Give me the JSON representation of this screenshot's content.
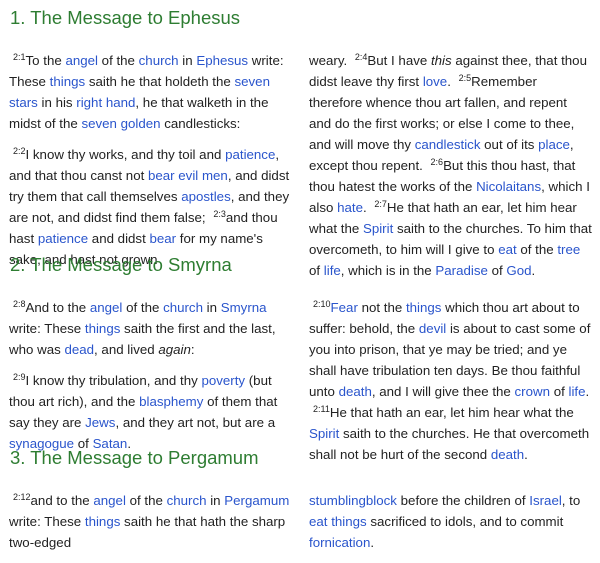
{
  "sections": [
    {
      "heading": "1. The Message to Ephesus",
      "left": [
        [
          {
            "t": "sup",
            "v": "2:1"
          },
          {
            "t": "txt",
            "v": "To the "
          },
          {
            "t": "lnk",
            "v": "angel"
          },
          {
            "t": "txt",
            "v": " of the "
          },
          {
            "t": "lnk",
            "v": "church"
          },
          {
            "t": "txt",
            "v": " in "
          },
          {
            "t": "lnk",
            "v": "Ephesus"
          },
          {
            "t": "txt",
            "v": " write: These "
          },
          {
            "t": "lnk",
            "v": "things"
          },
          {
            "t": "txt",
            "v": " saith he that holdeth the "
          },
          {
            "t": "lnk",
            "v": "seven stars"
          },
          {
            "t": "txt",
            "v": " in his "
          },
          {
            "t": "lnk",
            "v": "right hand"
          },
          {
            "t": "txt",
            "v": ", he that walketh in the midst of the "
          },
          {
            "t": "lnk",
            "v": "seven golden"
          },
          {
            "t": "txt",
            "v": " candlesticks:"
          }
        ],
        [
          {
            "t": "sup",
            "v": "2:2"
          },
          {
            "t": "txt",
            "v": "I know thy works, and thy toil and "
          },
          {
            "t": "lnk",
            "v": "patience"
          },
          {
            "t": "txt",
            "v": ", and that thou canst not "
          },
          {
            "t": "lnk",
            "v": "bear evil men"
          },
          {
            "t": "txt",
            "v": ", and didst try them that call themselves "
          },
          {
            "t": "lnk",
            "v": "apostles"
          },
          {
            "t": "txt",
            "v": ", and they are not, and didst find them false; "
          },
          {
            "t": "sup",
            "v": "2:3"
          },
          {
            "t": "txt",
            "v": "and thou hast "
          },
          {
            "t": "lnk",
            "v": "patience"
          },
          {
            "t": "txt",
            "v": " and didst "
          },
          {
            "t": "lnk",
            "v": "bear"
          },
          {
            "t": "txt",
            "v": " for my name's sake, and hast not grown"
          }
        ]
      ],
      "right": [
        [
          {
            "t": "txt",
            "v": "weary. "
          },
          {
            "t": "sup",
            "v": "2:4"
          },
          {
            "t": "txt",
            "v": "But I have "
          },
          {
            "t": "it",
            "v": "this"
          },
          {
            "t": "txt",
            "v": " against thee, that thou didst leave thy first "
          },
          {
            "t": "lnk",
            "v": "love"
          },
          {
            "t": "txt",
            "v": ". "
          },
          {
            "t": "sup",
            "v": "2:5"
          },
          {
            "t": "txt",
            "v": "Remember therefore whence thou art fallen, and repent and do the first works; or else I come to thee, and will move thy "
          },
          {
            "t": "lnk",
            "v": "candlestick"
          },
          {
            "t": "txt",
            "v": " out of its "
          },
          {
            "t": "lnk",
            "v": "place"
          },
          {
            "t": "txt",
            "v": ", except thou repent. "
          },
          {
            "t": "sup",
            "v": "2:6"
          },
          {
            "t": "txt",
            "v": "But this thou hast, that thou hatest the works of the "
          },
          {
            "t": "lnk",
            "v": "Nicolaitans"
          },
          {
            "t": "txt",
            "v": ", which I also "
          },
          {
            "t": "lnk",
            "v": "hate"
          },
          {
            "t": "txt",
            "v": ". "
          },
          {
            "t": "sup",
            "v": "2:7"
          },
          {
            "t": "txt",
            "v": "He that hath an ear, let him hear what the "
          },
          {
            "t": "lnk",
            "v": "Spirit"
          },
          {
            "t": "txt",
            "v": " saith to the churches. To him that overcometh, to him will I give to "
          },
          {
            "t": "lnk",
            "v": "eat"
          },
          {
            "t": "txt",
            "v": " of the "
          },
          {
            "t": "lnk",
            "v": "tree"
          },
          {
            "t": "txt",
            "v": " of "
          },
          {
            "t": "lnk",
            "v": "life"
          },
          {
            "t": "txt",
            "v": ", which is in the "
          },
          {
            "t": "lnk",
            "v": "Paradise"
          },
          {
            "t": "txt",
            "v": " of "
          },
          {
            "t": "lnk",
            "v": "God"
          },
          {
            "t": "txt",
            "v": "."
          }
        ]
      ]
    },
    {
      "heading": "2. The Message to Smyrna",
      "left": [
        [
          {
            "t": "sup",
            "v": "2:8"
          },
          {
            "t": "txt",
            "v": "And to the "
          },
          {
            "t": "lnk",
            "v": "angel"
          },
          {
            "t": "txt",
            "v": " of the "
          },
          {
            "t": "lnk",
            "v": "church"
          },
          {
            "t": "txt",
            "v": " in "
          },
          {
            "t": "lnk",
            "v": "Smyrna"
          },
          {
            "t": "txt",
            "v": " write: These "
          },
          {
            "t": "lnk",
            "v": "things"
          },
          {
            "t": "txt",
            "v": " saith the first and the last, who was "
          },
          {
            "t": "lnk",
            "v": "dead"
          },
          {
            "t": "txt",
            "v": ", and lived "
          },
          {
            "t": "it",
            "v": "again"
          },
          {
            "t": "txt",
            "v": ":"
          }
        ],
        [
          {
            "t": "sup",
            "v": "2:9"
          },
          {
            "t": "txt",
            "v": "I know thy tribulation, and thy "
          },
          {
            "t": "lnk",
            "v": "poverty"
          },
          {
            "t": "txt",
            "v": " (but thou art rich), and the "
          },
          {
            "t": "lnk",
            "v": "blasphemy"
          },
          {
            "t": "txt",
            "v": " of them that say they are "
          },
          {
            "t": "lnk",
            "v": "Jews"
          },
          {
            "t": "txt",
            "v": ", and they art not, but are a "
          },
          {
            "t": "lnk",
            "v": "synagogue"
          },
          {
            "t": "txt",
            "v": " of "
          },
          {
            "t": "lnk",
            "v": "Satan"
          },
          {
            "t": "txt",
            "v": "."
          }
        ]
      ],
      "right": [
        [
          {
            "t": "sup",
            "v": "2:10"
          },
          {
            "t": "lnk",
            "v": "Fear"
          },
          {
            "t": "txt",
            "v": " not the "
          },
          {
            "t": "lnk",
            "v": "things"
          },
          {
            "t": "txt",
            "v": " which thou art about to suffer: behold, the "
          },
          {
            "t": "lnk",
            "v": "devil"
          },
          {
            "t": "txt",
            "v": " is about to cast some of you into prison, that ye may be tried; and ye shall have tribulation ten days. Be thou faithful unto "
          },
          {
            "t": "lnk",
            "v": "death"
          },
          {
            "t": "txt",
            "v": ", and I will give thee the "
          },
          {
            "t": "lnk",
            "v": "crown"
          },
          {
            "t": "txt",
            "v": " of "
          },
          {
            "t": "lnk",
            "v": "life"
          },
          {
            "t": "txt",
            "v": ". "
          },
          {
            "t": "sup",
            "v": "2:11"
          },
          {
            "t": "txt",
            "v": "He that hath an ear, let him hear what the "
          },
          {
            "t": "lnk",
            "v": "Spirit"
          },
          {
            "t": "txt",
            "v": " saith to the churches. He that overcometh shall not be hurt of the second "
          },
          {
            "t": "lnk",
            "v": "death"
          },
          {
            "t": "txt",
            "v": "."
          }
        ]
      ]
    },
    {
      "heading": "3. The Message to Pergamum",
      "left": [
        [
          {
            "t": "sup",
            "v": "2:12"
          },
          {
            "t": "txt",
            "v": "and to the "
          },
          {
            "t": "lnk",
            "v": "angel"
          },
          {
            "t": "txt",
            "v": " of the "
          },
          {
            "t": "lnk",
            "v": "church"
          },
          {
            "t": "txt",
            "v": " in "
          },
          {
            "t": "lnk",
            "v": "Pergamum"
          },
          {
            "t": "txt",
            "v": " write: These "
          },
          {
            "t": "lnk",
            "v": "things"
          },
          {
            "t": "txt",
            "v": " saith he that hath the sharp two-edged"
          }
        ]
      ],
      "right": [
        [
          {
            "t": "lnk",
            "v": "stumblingblock"
          },
          {
            "t": "txt",
            "v": " before the children of "
          },
          {
            "t": "lnk",
            "v": "Israel"
          },
          {
            "t": "txt",
            "v": ", to "
          },
          {
            "t": "lnk",
            "v": "eat"
          },
          {
            "t": "txt",
            "v": " "
          },
          {
            "t": "lnk",
            "v": "things"
          },
          {
            "t": "txt",
            "v": " sacrificed to idols, and to commit "
          },
          {
            "t": "lnk",
            "v": "fornication"
          },
          {
            "t": "txt",
            "v": "."
          }
        ]
      ]
    }
  ]
}
